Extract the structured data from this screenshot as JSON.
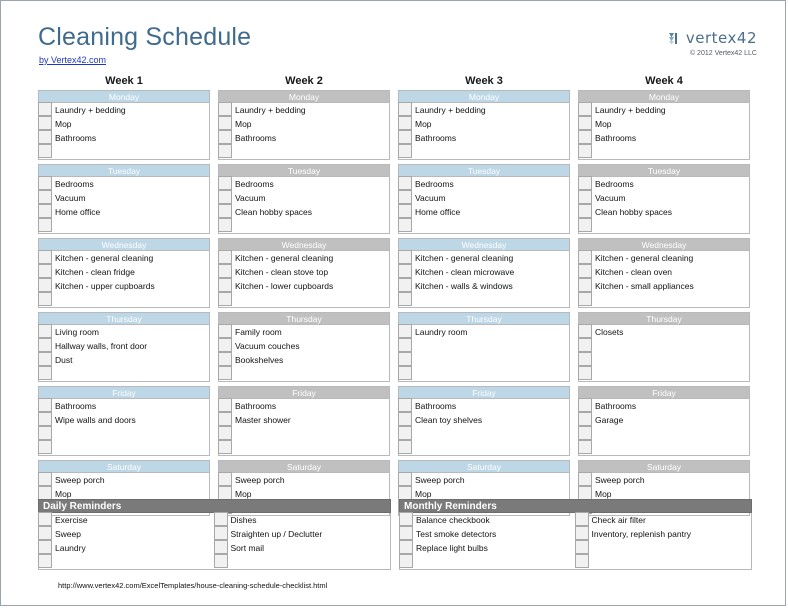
{
  "header": {
    "title": "Cleaning Schedule",
    "byline": "by Vertex42.com",
    "logo_word": "vertex42",
    "logo_mark": "vertex42-logo-icon",
    "copyright": "© 2012 Vertex42 LLC"
  },
  "colors": {
    "title_blue": "#3f6b8e",
    "header_blue": "#bdd7e7",
    "header_gray": "#c0c0c0",
    "reminder_header_gray": "#7a7a7a",
    "checkbox_fill": "#f1f1f1",
    "link_blue": "#1e36c8"
  },
  "weeks": [
    {
      "title": "Week 1",
      "tone": "blue",
      "days": [
        {
          "name": "Monday",
          "tasks": [
            "Laundry + bedding",
            "Mop",
            "Bathrooms"
          ],
          "rows": 4
        },
        {
          "name": "Tuesday",
          "tasks": [
            "Bedrooms",
            "Vacuum",
            "Home office"
          ],
          "rows": 4
        },
        {
          "name": "Wednesday",
          "tasks": [
            "Kitchen - general cleaning",
            "Kitchen - clean fridge",
            "Kitchen - upper cupboards"
          ],
          "rows": 4
        },
        {
          "name": "Thursday",
          "tasks": [
            "Living room",
            "Hallway walls, front door",
            "Dust"
          ],
          "rows": 4
        },
        {
          "name": "Friday",
          "tasks": [
            "Bathrooms",
            "Wipe walls and doors"
          ],
          "rows": 4
        },
        {
          "name": "Saturday",
          "tasks": [
            "Sweep porch",
            "Mop"
          ],
          "rows": 3
        }
      ]
    },
    {
      "title": "Week 2",
      "tone": "gray",
      "days": [
        {
          "name": "Monday",
          "tasks": [
            "Laundry + bedding",
            "Mop",
            "Bathrooms"
          ],
          "rows": 4
        },
        {
          "name": "Tuesday",
          "tasks": [
            "Bedrooms",
            "Vacuum",
            "Clean hobby spaces"
          ],
          "rows": 4
        },
        {
          "name": "Wednesday",
          "tasks": [
            "Kitchen - general cleaning",
            "Kitchen - clean stove top",
            "Kitchen - lower cupboards"
          ],
          "rows": 4
        },
        {
          "name": "Thursday",
          "tasks": [
            "Family room",
            "Vacuum couches",
            "Bookshelves"
          ],
          "rows": 4
        },
        {
          "name": "Friday",
          "tasks": [
            "Bathrooms",
            "Master shower"
          ],
          "rows": 4
        },
        {
          "name": "Saturday",
          "tasks": [
            "Sweep porch",
            "Mop"
          ],
          "rows": 3
        }
      ]
    },
    {
      "title": "Week 3",
      "tone": "blue",
      "days": [
        {
          "name": "Monday",
          "tasks": [
            "Laundry + bedding",
            "Mop",
            "Bathrooms"
          ],
          "rows": 4
        },
        {
          "name": "Tuesday",
          "tasks": [
            "Bedrooms",
            "Vacuum",
            "Home office"
          ],
          "rows": 4
        },
        {
          "name": "Wednesday",
          "tasks": [
            "Kitchen - general cleaning",
            "Kitchen - clean microwave",
            "Kitchen - walls & windows"
          ],
          "rows": 4
        },
        {
          "name": "Thursday",
          "tasks": [
            "Laundry room"
          ],
          "rows": 4
        },
        {
          "name": "Friday",
          "tasks": [
            "Bathrooms",
            "Clean toy shelves"
          ],
          "rows": 4
        },
        {
          "name": "Saturday",
          "tasks": [
            "Sweep porch",
            "Mop"
          ],
          "rows": 3
        }
      ]
    },
    {
      "title": "Week 4",
      "tone": "gray",
      "days": [
        {
          "name": "Monday",
          "tasks": [
            "Laundry + bedding",
            "Mop",
            "Bathrooms"
          ],
          "rows": 4
        },
        {
          "name": "Tuesday",
          "tasks": [
            "Bedrooms",
            "Vacuum",
            "Clean hobby spaces"
          ],
          "rows": 4
        },
        {
          "name": "Wednesday",
          "tasks": [
            "Kitchen - general cleaning",
            "Kitchen - clean oven",
            "Kitchen - small appliances"
          ],
          "rows": 4
        },
        {
          "name": "Thursday",
          "tasks": [
            "Closets"
          ],
          "rows": 4
        },
        {
          "name": "Friday",
          "tasks": [
            "Bathrooms",
            "Garage"
          ],
          "rows": 4
        },
        {
          "name": "Saturday",
          "tasks": [
            "Sweep porch",
            "Mop"
          ],
          "rows": 3
        }
      ]
    }
  ],
  "reminders": [
    {
      "title": "Daily Reminders",
      "columns": [
        {
          "tasks": [
            "Exercise",
            "Sweep",
            "Laundry"
          ],
          "rows": 4
        },
        {
          "tasks": [
            "Dishes",
            "Straighten up / Declutter",
            "Sort mail"
          ],
          "rows": 4
        }
      ]
    },
    {
      "title": "Monthly Reminders",
      "columns": [
        {
          "tasks": [
            "Balance checkbook",
            "Test smoke detectors",
            "Replace light bulbs"
          ],
          "rows": 4
        },
        {
          "tasks": [
            "Check air filter",
            "Inventory, replenish pantry"
          ],
          "rows": 4
        }
      ]
    }
  ],
  "footer": {
    "url": "http://www.vertex42.com/ExcelTemplates/house-cleaning-schedule-checklist.html"
  }
}
